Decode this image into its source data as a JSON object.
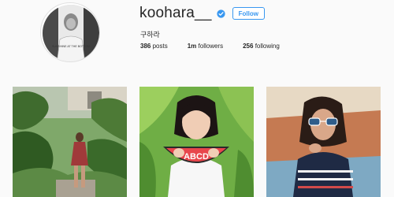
{
  "profile": {
    "username": "koohara__",
    "verified_icon": "verified-badge-icon",
    "follow_label": "Follow",
    "full_name": "구하라",
    "avatar_text": "SUNSHINE AT THE BOTTOM",
    "stats": {
      "posts_count": "386",
      "posts_label": "posts",
      "followers_count": "1m",
      "followers_label": "followers",
      "following_count": "256",
      "following_label": "following"
    }
  },
  "grid": {
    "photos": [
      "garden-photo",
      "watermelon-clutch-photo",
      "sunglasses-photo"
    ],
    "watermelon_text": "ABCD"
  },
  "colors": {
    "accent": "#3897f0",
    "background": "#fafafa",
    "text": "#262626"
  }
}
